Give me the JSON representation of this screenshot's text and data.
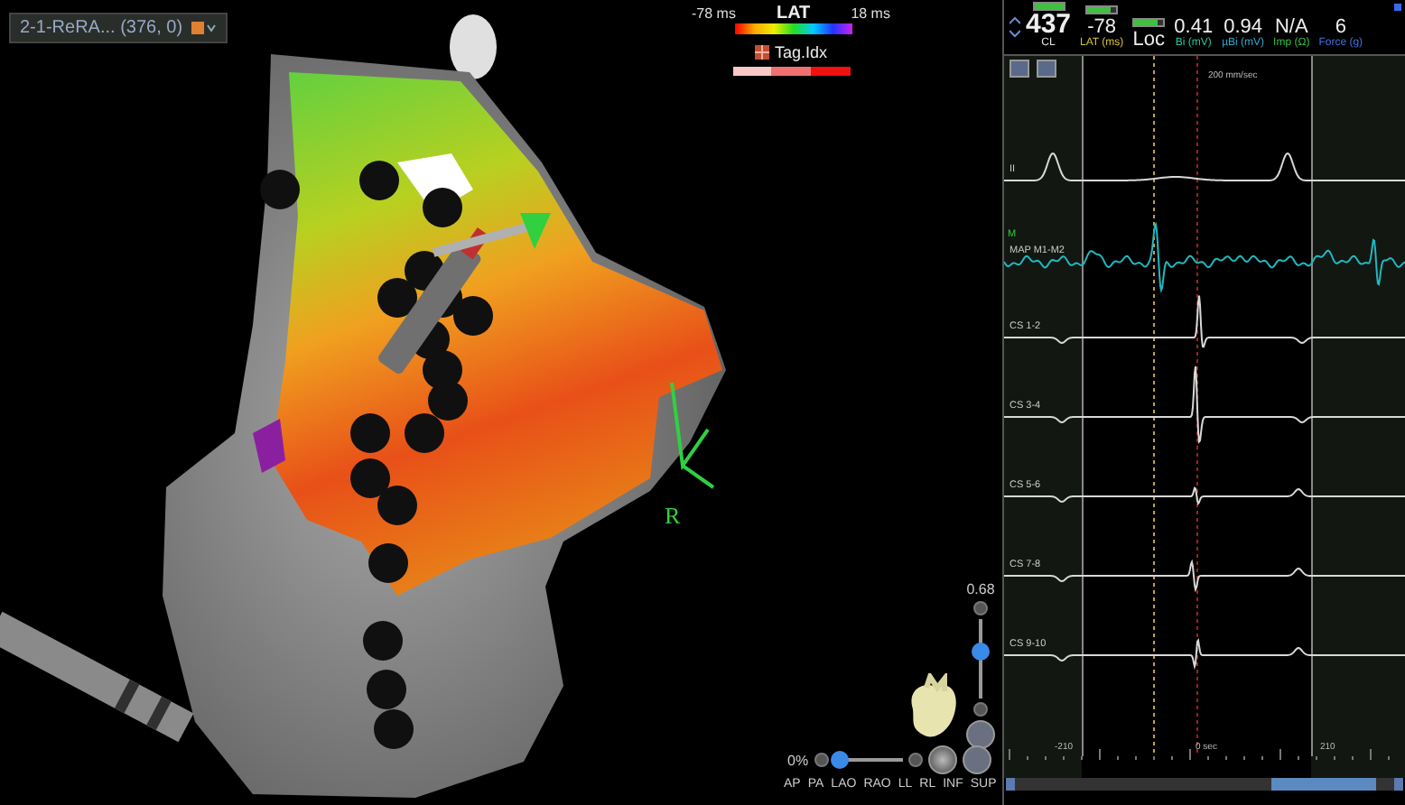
{
  "map_view": {
    "title": "2-1-ReRA... (376, 0)",
    "lat_legend": {
      "title": "LAT",
      "min": "-78 ms",
      "max": "18 ms"
    },
    "tag_legend": {
      "title": "Tag.Idx"
    },
    "marker_label": "R",
    "opacity": {
      "reading": "0.68",
      "level": 0.6
    },
    "zoom": {
      "reading": "0%",
      "level": 0.1
    },
    "views": [
      "AP",
      "PA",
      "LAO",
      "RAO",
      "LL",
      "RL",
      "INF",
      "SUP"
    ]
  },
  "readouts": [
    {
      "value": "437",
      "label": "CL",
      "color": "#e8e8e8",
      "level": 1
    },
    {
      "value": "-78",
      "label": "LAT (ms)",
      "color": "#d8c030",
      "level": 0.8
    },
    {
      "value": "Loc",
      "level": 0.8
    },
    {
      "value": "0.41",
      "label": "Bi (mV)",
      "color": "#30c0a0"
    },
    {
      "value": "0.94",
      "label": "µBi (mV)",
      "color": "#30a8d0"
    },
    {
      "value": "N/A",
      "label": "Imp (Ω)",
      "color": "#30c040"
    },
    {
      "value": "6",
      "label": "Force (g)",
      "color": "#4070e0"
    }
  ],
  "signals": {
    "speed": "200 mm/sec",
    "time_zero": "0 sec",
    "left_time": "-210",
    "right_time": "210",
    "channels": [
      {
        "name": "II",
        "color": "#d8d8d8"
      },
      {
        "name": "MAP M1-M2",
        "tag": "M",
        "color": "#20b8c0"
      },
      {
        "name": "CS 1-2",
        "color": "#d8d8d8"
      },
      {
        "name": "CS 3-4",
        "color": "#d8d8d8"
      },
      {
        "name": "CS 5-6",
        "color": "#d8d8d8"
      },
      {
        "name": "CS 7-8",
        "color": "#d8d8d8"
      },
      {
        "name": "CS 9-10",
        "color": "#d8d8d8"
      }
    ]
  }
}
